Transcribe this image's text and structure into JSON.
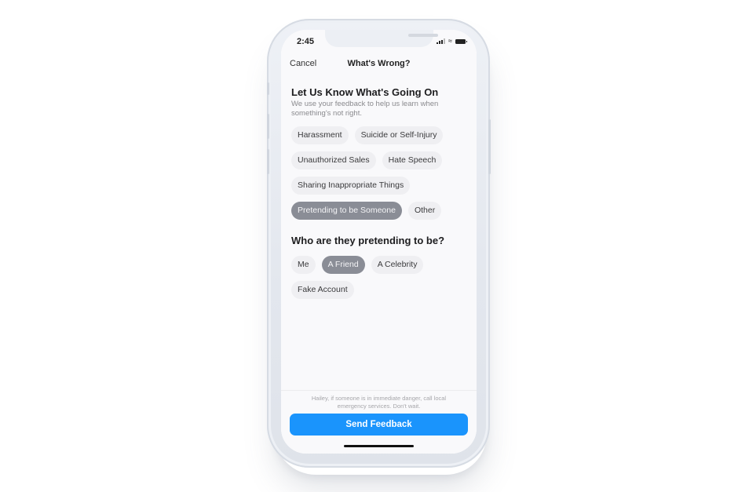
{
  "status_bar": {
    "time": "2:45",
    "icons": [
      "cellular-signal-icon",
      "wifi-icon",
      "battery-icon"
    ]
  },
  "nav": {
    "cancel_label": "Cancel",
    "title": "What's Wrong?"
  },
  "section1": {
    "heading": "Let Us Know What's Going On",
    "description": "We use your feedback to help us learn when something's not right.",
    "options": [
      {
        "label": "Harassment",
        "selected": false
      },
      {
        "label": "Suicide or Self-Injury",
        "selected": false
      },
      {
        "label": "Unauthorized Sales",
        "selected": false
      },
      {
        "label": "Hate Speech",
        "selected": false
      },
      {
        "label": "Sharing Inappropriate Things",
        "selected": false
      },
      {
        "label": "Pretending to be Someone",
        "selected": true
      },
      {
        "label": "Other",
        "selected": false
      }
    ]
  },
  "section2": {
    "heading": "Who are they pretending to be?",
    "options": [
      {
        "label": "Me",
        "selected": false
      },
      {
        "label": "A Friend",
        "selected": true
      },
      {
        "label": "A Celebrity",
        "selected": false
      },
      {
        "label": "Fake Account",
        "selected": false
      }
    ]
  },
  "footer": {
    "note": "Hailey, if someone is in immediate danger, call local emergency services. Don't wait.",
    "send_label": "Send Feedback"
  },
  "colors": {
    "accent": "#1a94fc",
    "chip_bg": "#efeff2",
    "chip_selected_bg": "#8a8d96"
  }
}
